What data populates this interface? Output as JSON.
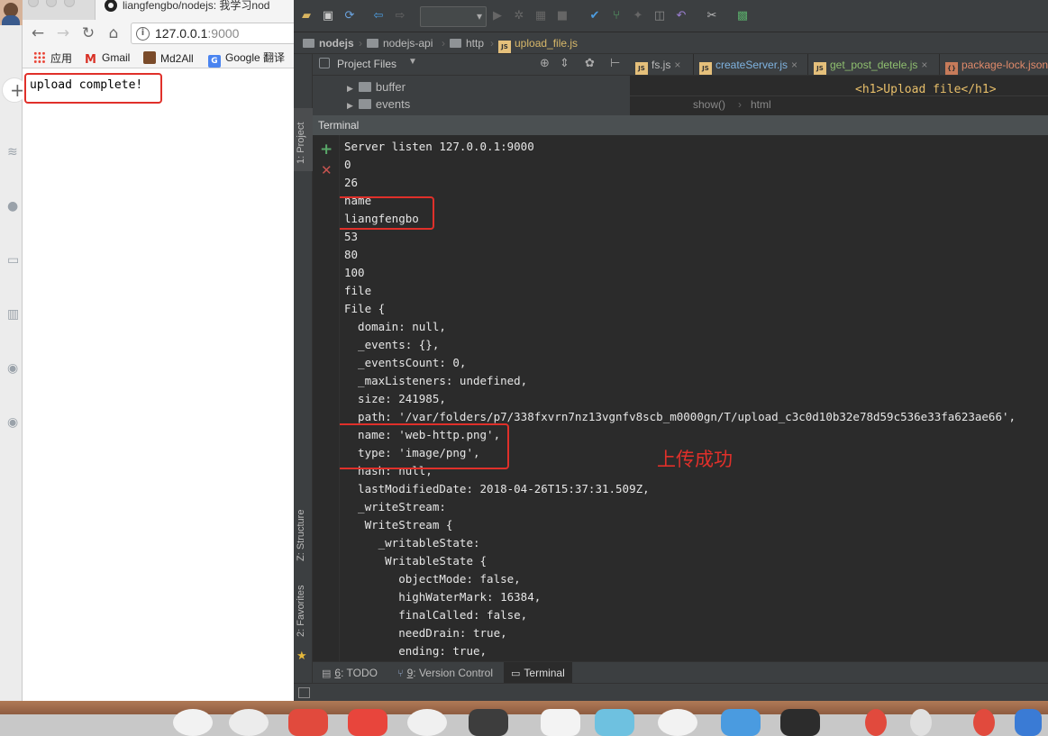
{
  "chrome": {
    "tab_title": "liangfengbo/nodejs: 我学习nod",
    "url_host": "127.0.0.1",
    "url_port": ":9000",
    "bookmarks": [
      "应用",
      "Gmail",
      "Md2All",
      "Google 翻译"
    ],
    "page_text": "upload complete!"
  },
  "ide": {
    "breadcrumbs": [
      "nodejs",
      "nodejs-api",
      "http",
      "upload_file.js"
    ],
    "side_tabs": {
      "project": "1: Project",
      "structure": "Z: Structure",
      "favorites": "2: Favorites"
    },
    "project_panel_title": "Project Files",
    "tree_items": [
      "buffer",
      "events"
    ],
    "editor_tabs": [
      "fs.js",
      "createServer.js",
      "get_post_detele.js",
      "package-lock.json"
    ],
    "editor_code": "<h1>Upload file</h1>",
    "editor_crumbs": [
      "show()",
      "html"
    ],
    "terminal_title": "Terminal",
    "terminal_lines": [
      "Server listen 127.0.0.1:9000",
      "0",
      "26",
      "name",
      "liangfengbo",
      "53",
      "80",
      "100",
      "file",
      "File {",
      "  domain: null,",
      "  _events: {},",
      "  _eventsCount: 0,",
      "  _maxListeners: undefined,",
      "  size: 241985,",
      "  path: '/var/folders/p7/338fxvrn7nz13vgnfv8scb_m0000gn/T/upload_c3c0d10b32e78d59c536e33fa623ae66',",
      "  name: 'web-http.png',",
      "  type: 'image/png',",
      "  hash: null,",
      "  lastModifiedDate: 2018-04-26T15:37:31.509Z,",
      "  _writeStream:",
      "   WriteStream {",
      "     _writableState:",
      "      WritableState {",
      "        objectMode: false,",
      "        highWaterMark: 16384,",
      "        finalCalled: false,",
      "        needDrain: true,",
      "        ending: true,"
    ],
    "annotation": "上传成功",
    "bottom_tabs": {
      "todo_num": "6",
      "todo_label": ": TODO",
      "vc_num": "9",
      "vc_label": ": Version Control",
      "terminal_label": "Terminal"
    }
  },
  "colors": {
    "annotation_red": "#e0302a",
    "ide_bg": "#2b2b2b",
    "ide_panel": "#3c3f41"
  }
}
